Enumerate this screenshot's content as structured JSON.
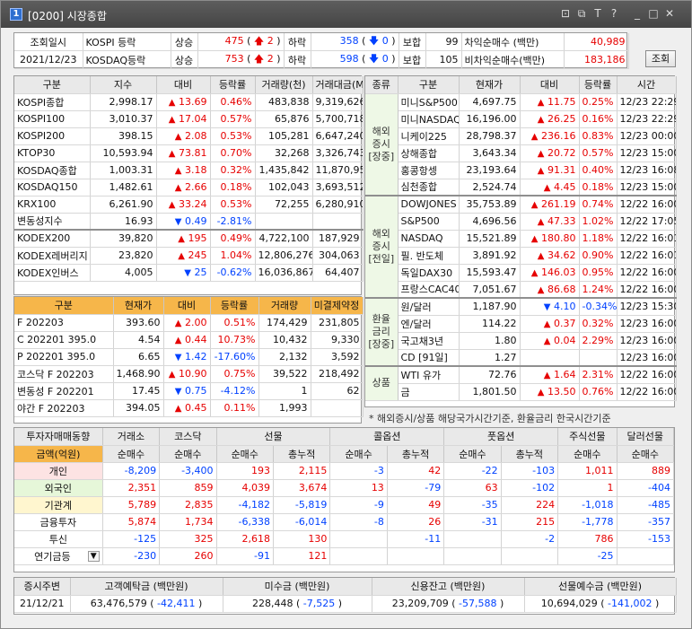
{
  "window": {
    "badge": "1",
    "title": "[0200] 시장종합",
    "icons": [
      "layout-icon",
      "copy-icon",
      "text-icon",
      "help-icon",
      "minimize-icon",
      "maximize-icon",
      "close-icon"
    ],
    "icon_glyphs": [
      "⊡",
      "⧉",
      "T",
      "?",
      "_",
      "□",
      "✕"
    ]
  },
  "summary": {
    "label1": "조회일시",
    "label2": "2021/12/23",
    "rows": [
      {
        "market": "KOSPI 등락",
        "up_label": "상승",
        "up": "475",
        "upper_arrow": "🡅",
        "upper": "2",
        "down_label": "하락",
        "down": "358",
        "lower_arrow": "🡇",
        "lower": "0",
        "flat_label": "보합",
        "flat": "99",
        "net_label": "차익순매수  (백만)",
        "net": "40,989"
      },
      {
        "market": "KOSDAQ등락",
        "up_label": "상승",
        "up": "753",
        "upper_arrow": "🡅",
        "upper": "2",
        "down_label": "하락",
        "down": "598",
        "lower_arrow": "🡇",
        "lower": "0",
        "flat_label": "보합",
        "flat": "105",
        "net_label": "비차익순매수(백만)",
        "net": "183,186"
      }
    ],
    "query_button": "조회"
  },
  "index_table": {
    "headers": [
      "구분",
      "지수",
      "대비",
      "등락률",
      "거래량(천)",
      "거래대금(M)"
    ],
    "rows": [
      [
        "KOSPI종합",
        "2,998.17",
        "▲",
        "13.69",
        "0.46%",
        "483,838",
        "9,319,626",
        "r"
      ],
      [
        "KOSPI100",
        "3,010.37",
        "▲",
        "17.04",
        "0.57%",
        "65,876",
        "5,700,718",
        "r"
      ],
      [
        "KOSPI200",
        "398.15",
        "▲",
        "2.08",
        "0.53%",
        "105,281",
        "6,647,240",
        "r"
      ],
      [
        "KTOP30",
        "10,593.94",
        "▲",
        "73.81",
        "0.70%",
        "32,268",
        "3,326,743",
        "r"
      ],
      [
        "KOSDAQ종합",
        "1,003.31",
        "▲",
        "3.18",
        "0.32%",
        "1,435,842",
        "11,870,959",
        "r"
      ],
      [
        "KOSDAQ150",
        "1,482.61",
        "▲",
        "2.66",
        "0.18%",
        "102,043",
        "3,693,512",
        "r"
      ],
      [
        "KRX100",
        "6,261.90",
        "▲",
        "33.24",
        "0.53%",
        "72,255",
        "6,280,910",
        "r"
      ],
      [
        "변동성지수",
        "16.93",
        "▼",
        "0.49",
        "-2.81%",
        "",
        "",
        "b"
      ]
    ],
    "etf_rows": [
      [
        "KODEX200",
        "39,820",
        "▲",
        "195",
        "0.49%",
        "4,722,100",
        "187,929",
        "r"
      ],
      [
        "KODEX레버리지",
        "23,820",
        "▲",
        "245",
        "1.04%",
        "12,806,276",
        "304,063",
        "r"
      ],
      [
        "KODEX인버스",
        "4,005",
        "▼",
        "25",
        "-0.62%",
        "16,036,867",
        "64,407",
        "b"
      ]
    ]
  },
  "futures_table": {
    "headers": [
      "구분",
      "현재가",
      "대비",
      "등락률",
      "거래량",
      "미결제약정"
    ],
    "rows": [
      [
        "F 202203",
        "393.60",
        "▲",
        "2.00",
        "0.51%",
        "174,429",
        "231,805",
        "r"
      ],
      [
        "C 202201 395.0",
        "4.54",
        "▲",
        "0.44",
        "10.73%",
        "10,432",
        "9,330",
        "r"
      ],
      [
        "P 202201 395.0",
        "6.65",
        "▼",
        "1.42",
        "-17.60%",
        "2,132",
        "3,592",
        "b"
      ],
      [
        "코스닥 F 202203",
        "1,468.90",
        "▲",
        "10.90",
        "0.75%",
        "39,522",
        "218,492",
        "r"
      ],
      [
        "변동성 F 202201",
        "17.45",
        "▼",
        "0.75",
        "-4.12%",
        "1",
        "62",
        "b"
      ],
      [
        "야간 F 202203",
        "394.05",
        "▲",
        "0.45",
        "0.11%",
        "1,993",
        "",
        "r"
      ]
    ]
  },
  "global_table": {
    "headers": [
      "종류",
      "구분",
      "현재가",
      "대비",
      "등락률",
      "시간"
    ],
    "groups": [
      {
        "label": "해외\n증시\n[장중]",
        "rows": [
          [
            "미니S&P500",
            "4,697.75",
            "▲",
            "11.75",
            "0.25%",
            "12/23 22:29",
            "r"
          ],
          [
            "미니NASDAQ",
            "16,196.00",
            "▲",
            "26.25",
            "0.16%",
            "12/23 22:29",
            "r"
          ],
          [
            "니케이225",
            "28,798.37",
            "▲",
            "236.16",
            "0.83%",
            "12/23 00:00",
            "r"
          ],
          [
            "상해종합",
            "3,643.34",
            "▲",
            "20.72",
            "0.57%",
            "12/23 15:00",
            "r"
          ],
          [
            "홍콩항셍",
            "23,193.64",
            "▲",
            "91.31",
            "0.40%",
            "12/23 16:08",
            "r"
          ],
          [
            "심천종합",
            "2,524.74",
            "▲",
            "4.45",
            "0.18%",
            "12/23 15:00",
            "r"
          ]
        ]
      },
      {
        "label": "해외\n증시\n[전일]",
        "rows": [
          [
            "DOWJONES",
            "35,753.89",
            "▲",
            "261.19",
            "0.74%",
            "12/22 16:00",
            "r"
          ],
          [
            "S&P500",
            "4,696.56",
            "▲",
            "47.33",
            "1.02%",
            "12/22 17:05",
            "r"
          ],
          [
            "NASDAQ",
            "15,521.89",
            "▲",
            "180.80",
            "1.18%",
            "12/22 16:01",
            "r"
          ],
          [
            "필. 반도체",
            "3,891.92",
            "▲",
            "34.62",
            "0.90%",
            "12/22 16:01",
            "r"
          ],
          [
            "독일DAX30",
            "15,593.47",
            "▲",
            "146.03",
            "0.95%",
            "12/22 16:00",
            "r"
          ],
          [
            "프랑스CAC40",
            "7,051.67",
            "▲",
            "86.68",
            "1.24%",
            "12/22 16:00",
            "r"
          ]
        ]
      },
      {
        "label": "환율\n금리\n[장중]",
        "rows": [
          [
            "원/달러",
            "1,187.90",
            "▼",
            "4.10",
            "-0.34%",
            "12/23 15:30",
            "b"
          ],
          [
            "엔/달러",
            "114.22",
            "▲",
            "0.37",
            "0.32%",
            "12/23 16:00",
            "r"
          ],
          [
            "국고채3년",
            "1.80",
            "▲",
            "0.04",
            "2.29%",
            "12/23 16:00",
            "r"
          ],
          [
            "CD [91일]",
            "1.27",
            "",
            "",
            "",
            "12/23 16:00",
            "k"
          ]
        ]
      },
      {
        "label": "상품",
        "rows": [
          [
            "WTI 유가",
            "72.76",
            "▲",
            "1.64",
            "2.31%",
            "12/22 16:00",
            "r"
          ],
          [
            "금",
            "1,801.50",
            "▲",
            "13.50",
            "0.76%",
            "12/22 16:00",
            "r"
          ]
        ]
      }
    ],
    "note": "* 해외증시/상품 해당국가시간기준, 환율금리 한국시간기준"
  },
  "investor_table": {
    "top_headers": [
      "투자자매매동향",
      "거래소",
      "코스닥",
      "선물",
      "콜옵션",
      "풋옵션",
      "주식선물",
      "달러선물"
    ],
    "sub_headers": [
      "금액(억원)",
      "순매수",
      "순매수",
      "순매수",
      "총누적",
      "순매수",
      "총누적",
      "순매수",
      "총누적",
      "순매수",
      "순매수"
    ],
    "rows": [
      {
        "name": "개인",
        "cls": "pink",
        "vals": [
          [
            "-8,209",
            "b"
          ],
          [
            "-3,400",
            "b"
          ],
          [
            "193",
            "r"
          ],
          [
            "2,115",
            "r"
          ],
          [
            "-3",
            "b"
          ],
          [
            "42",
            "r"
          ],
          [
            "-22",
            "b"
          ],
          [
            "-103",
            "b"
          ],
          [
            "1,011",
            "r"
          ],
          [
            "889",
            "r"
          ]
        ]
      },
      {
        "name": "외국인",
        "cls": "lgreen",
        "vals": [
          [
            "2,351",
            "r"
          ],
          [
            "859",
            "r"
          ],
          [
            "4,039",
            "r"
          ],
          [
            "3,674",
            "r"
          ],
          [
            "13",
            "r"
          ],
          [
            "-79",
            "b"
          ],
          [
            "63",
            "r"
          ],
          [
            "-102",
            "b"
          ],
          [
            "1",
            "r"
          ],
          [
            "-404",
            "b"
          ]
        ]
      },
      {
        "name": "기관계",
        "cls": "lyellow",
        "vals": [
          [
            "5,789",
            "r"
          ],
          [
            "2,835",
            "r"
          ],
          [
            "-4,182",
            "b"
          ],
          [
            "-5,819",
            "b"
          ],
          [
            "-9",
            "b"
          ],
          [
            "49",
            "r"
          ],
          [
            "-35",
            "b"
          ],
          [
            "224",
            "r"
          ],
          [
            "-1,018",
            "b"
          ],
          [
            "-485",
            "b"
          ]
        ]
      },
      {
        "name": "금융투자",
        "cls": "",
        "vals": [
          [
            "5,874",
            "r"
          ],
          [
            "1,734",
            "r"
          ],
          [
            "-6,338",
            "b"
          ],
          [
            "-6,014",
            "b"
          ],
          [
            "-8",
            "b"
          ],
          [
            "26",
            "r"
          ],
          [
            "-31",
            "b"
          ],
          [
            "215",
            "r"
          ],
          [
            "-1,778",
            "b"
          ],
          [
            "-357",
            "b"
          ]
        ]
      },
      {
        "name": "투신",
        "cls": "",
        "vals": [
          [
            "-125",
            "b"
          ],
          [
            "325",
            "r"
          ],
          [
            "2,618",
            "r"
          ],
          [
            "130",
            "r"
          ],
          [
            "",
            "k"
          ],
          [
            "-11",
            "b"
          ],
          [
            "",
            "k"
          ],
          [
            "-2",
            "b"
          ],
          [
            "786",
            "r"
          ],
          [
            "-153",
            "b"
          ]
        ]
      },
      {
        "name": "연기금등",
        "cls": "",
        "vals": [
          [
            "-230",
            "b"
          ],
          [
            "260",
            "r"
          ],
          [
            "-91",
            "b"
          ],
          [
            "121",
            "r"
          ],
          [
            "",
            "k"
          ],
          [
            "",
            "k"
          ],
          [
            "",
            "k"
          ],
          [
            "",
            "k"
          ],
          [
            "-25",
            "b"
          ],
          [
            "",
            "k"
          ]
        ]
      }
    ],
    "dropdown_arrow": "▼"
  },
  "footer": {
    "headers": [
      "증시주변",
      "고객예탁금 (백만원)",
      "미수금 (백만원)",
      "신용잔고 (백만원)",
      "선물예수금 (백만원)"
    ],
    "date": "21/12/21",
    "items": [
      {
        "value": "63,476,579",
        "change": "-42,411"
      },
      {
        "value": "228,448",
        "change": "-7,525"
      },
      {
        "value": "23,209,709",
        "change": "-57,588"
      },
      {
        "value": "10,694,029",
        "change": "-141,002"
      }
    ],
    "paren_open": "(",
    "paren_close": ")"
  },
  "colors": {
    "red": "#e60000",
    "blue": "#0041ff",
    "header_orange": "#f6b64a",
    "green_band": "#eef8e6"
  }
}
